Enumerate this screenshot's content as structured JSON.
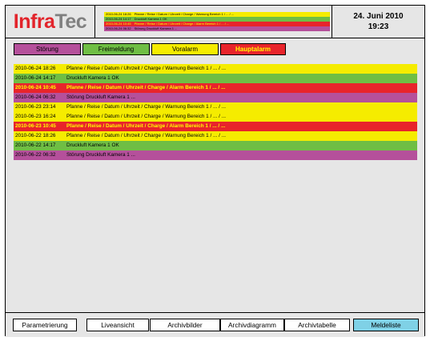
{
  "logo": {
    "part1": "Infra",
    "part2": "Tec"
  },
  "header": {
    "date": "24. Juni 2010",
    "time": "19:23"
  },
  "mini_messages": [
    {
      "time": "2010-06-24 18:26",
      "text": "Pfanne / Reise / Datum / Uhrzeit / Charge / Warnung Bereich 1 / ... / ...",
      "bg": "#f5ec00",
      "fg": "#000000"
    },
    {
      "time": "2010-06-24 14:17",
      "text": "Druckluft Kamera 1 OK",
      "bg": "#6fbe44",
      "fg": "#000000"
    },
    {
      "time": "2010-06-24 10:45",
      "text": "Pfanne / Reise / Datum / Uhrzeit / Charge / Alarm Bereich 1 / ... / ...",
      "bg": "#e8242b",
      "fg": "#ffff00"
    },
    {
      "time": "2010-06-24 06:32",
      "text": "Störung Druckluft Kamera 1 ...",
      "bg": "#b5509b",
      "fg": "#000000"
    }
  ],
  "filters": [
    {
      "label": "Störung",
      "bg": "#b5509b",
      "fg": "#000000"
    },
    {
      "label": "Freimeldung",
      "bg": "#6fbe44",
      "fg": "#000000"
    },
    {
      "label": "Voralarm",
      "bg": "#f5ec00",
      "fg": "#000000"
    },
    {
      "label": "Hauptalarm",
      "bg": "#e8242b",
      "fg": "#ffff00"
    }
  ],
  "messages": [
    {
      "time": "2010-06-24 18:26",
      "text": "Pfanne / Reise / Datum / Uhrzeit / Charge / Warnung Bereich 1 / ... / ...",
      "bg": "#f5ec00",
      "fg": "#000000"
    },
    {
      "time": "2010-06-24 14:17",
      "text": "Druckluft Kamera 1 OK",
      "bg": "#6fbe44",
      "fg": "#000000"
    },
    {
      "time": "2010-06-24 10:45",
      "text": "Pfanne / Reise / Datum / Uhrzeit / Charge / Alarm Bereich 1 / ... / ...",
      "bg": "#e8242b",
      "fg": "#ffff00"
    },
    {
      "time": "2010-06-24 06:32",
      "text": "Störung Druckluft Kamera 1 ...",
      "bg": "#b5509b",
      "fg": "#000000"
    },
    {
      "time": "2010-06-23 23:14",
      "text": "Pfanne / Reise / Datum / Uhrzeit / Charge / Warnung Bereich 1 / ... / ...",
      "bg": "#f5ec00",
      "fg": "#000000"
    },
    {
      "time": "2010-06-23 16:24",
      "text": "Pfanne / Reise / Datum / Uhrzeit / Charge / Warnung Bereich 1 / ... / ...",
      "bg": "#f5ec00",
      "fg": "#000000"
    },
    {
      "time": "2010-06-23 10:45",
      "text": "Pfanne / Reise / Datum / Uhrzeit / Charge / Alarm Bereich 1 / ... / ...",
      "bg": "#e8242b",
      "fg": "#ffff00"
    },
    {
      "time": "2010-06-22 18:26",
      "text": "Pfanne / Reise / Datum / Uhrzeit / Charge / Warnung Bereich 1 / ... / ...",
      "bg": "#f5ec00",
      "fg": "#000000"
    },
    {
      "time": "2010-06-22 14:17",
      "text": "Druckluft Kamera 1 OK",
      "bg": "#6fbe44",
      "fg": "#000000"
    },
    {
      "time": "2010-06-22 06:32",
      "text": "Störung Druckluft Kamera 1 ...",
      "bg": "#b5509b",
      "fg": "#000000"
    }
  ],
  "nav": [
    {
      "label": "Parametrierung",
      "active": false
    },
    {
      "label": "Liveansicht",
      "active": false
    },
    {
      "label": "Archivbilder",
      "active": false
    },
    {
      "label": "Archivdiagramm",
      "active": false
    },
    {
      "label": "Archivtabelle",
      "active": false
    },
    {
      "label": "Meldeliste",
      "active": true
    }
  ],
  "colors": {
    "active_nav": "#7fd1e6",
    "panel": "#e6e6e6"
  }
}
